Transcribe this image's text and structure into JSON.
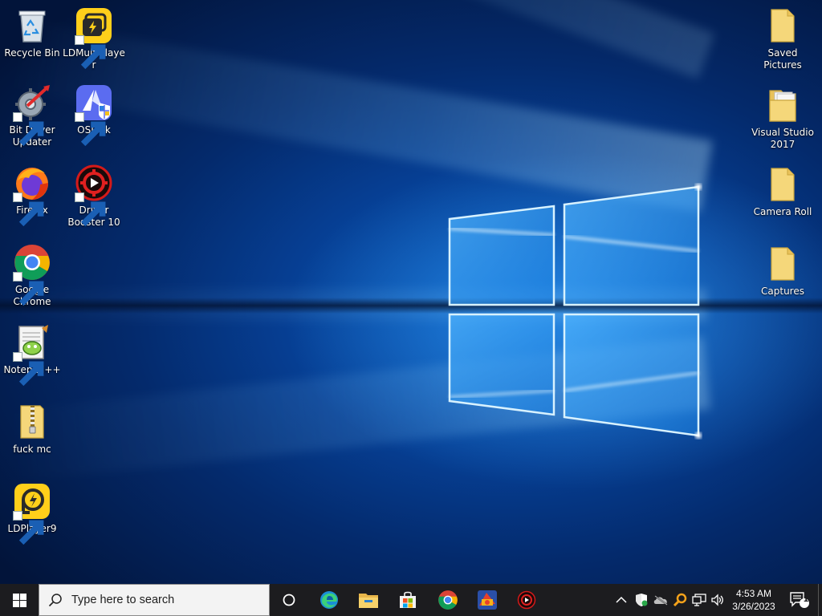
{
  "desktop": {
    "icons_left": [
      {
        "label": "Recycle Bin",
        "icon": "recycle-bin-icon"
      },
      {
        "label": "LDMultiPlayer",
        "icon": "ldmultiplayer-icon"
      },
      {
        "label": "Bit Driver Updater",
        "icon": "bit-driver-updater-icon"
      },
      {
        "label": "OSLink",
        "icon": "oslink-icon"
      },
      {
        "label": "Firefox",
        "icon": "firefox-icon"
      },
      {
        "label": "Driver Booster 10",
        "icon": "driver-booster-icon"
      },
      {
        "label": "Google Chrome",
        "icon": "chrome-icon"
      },
      {
        "label": "Notepad++",
        "icon": "notepad-plus-plus-icon"
      },
      {
        "label": "fuck mc",
        "icon": "zip-folder-icon"
      },
      {
        "label": "LDPlayer9",
        "icon": "ldplayer-icon"
      }
    ],
    "icons_right": [
      {
        "label": "Saved Pictures",
        "icon": "folder-icon"
      },
      {
        "label": "Visual Studio 2017",
        "icon": "folder-icon"
      },
      {
        "label": "Camera Roll",
        "icon": "folder-icon"
      },
      {
        "label": "Captures",
        "icon": "folder-icon"
      }
    ]
  },
  "taskbar": {
    "search_placeholder": "Type here to search",
    "pinned": [
      "cortana-icon",
      "edge-icon",
      "file-explorer-icon",
      "microsoft-store-icon",
      "chrome-icon",
      "app-icon",
      "driver-booster-icon"
    ],
    "tray": [
      "chevron-up-icon",
      "security-shield-icon",
      "onedrive-icon",
      "search-tool-icon",
      "network-icon",
      "volume-icon"
    ],
    "clock_time": "4:53 AM",
    "clock_date": "3/26/2023",
    "notification_count": "1"
  },
  "colors": {
    "taskbar_bg": "#1c1c1f",
    "desktop_blue": "#0a5fc4",
    "search_bg": "#f3f3f3"
  }
}
